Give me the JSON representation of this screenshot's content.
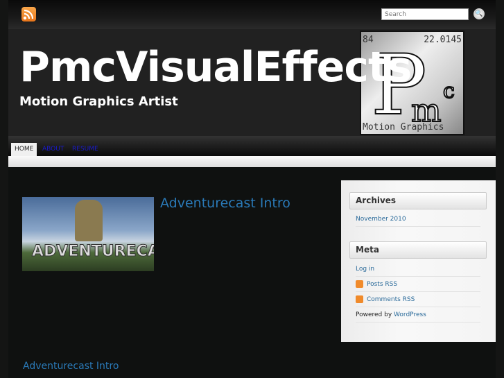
{
  "site": {
    "title": "PmcVisualEffects",
    "tagline": "Motion Graphics Artist"
  },
  "logo": {
    "number": "84",
    "weight": "22.0145",
    "letters": "Pmc",
    "label": "Motion Graphics"
  },
  "search": {
    "placeholder": "Search"
  },
  "nav": [
    {
      "label": "HOME"
    },
    {
      "label": "ABOUT"
    },
    {
      "label": "RESUME"
    }
  ],
  "post": {
    "title": "Adventurecast Intro",
    "thumb_text": "ADVENTURECAST",
    "second_title": "Adventurecast Intro"
  },
  "sidebar": {
    "archives": {
      "title": "Archives",
      "items": [
        "November 2010"
      ]
    },
    "meta": {
      "title": "Meta",
      "login": "Log in",
      "posts_rss": "Posts RSS",
      "comments_rss": "Comments RSS",
      "powered_prefix": "Powered by",
      "powered_link": "WordPress"
    }
  }
}
